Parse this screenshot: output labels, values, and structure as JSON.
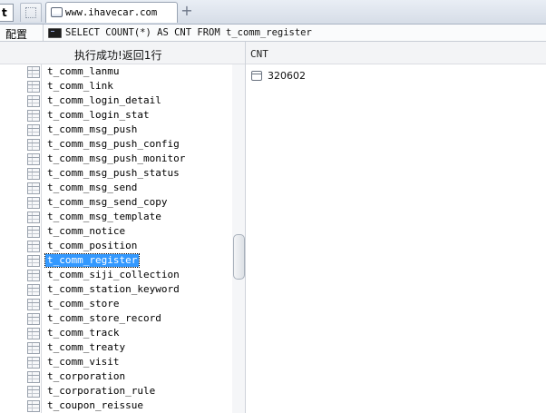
{
  "tab_bar": {
    "left_stub": "t",
    "active_tab_title": "www.ihavecar.com",
    "new_tab_symbol": "+"
  },
  "toolbar": {
    "config_label": "配置",
    "sql_text": "SELECT COUNT(*) AS CNT FROM t_comm_register"
  },
  "result": {
    "status": "执行成功!返回1行",
    "column_header": "CNT",
    "rows": [
      "320602"
    ]
  },
  "tables": [
    {
      "label": "t_comm_lanmu",
      "selected": false
    },
    {
      "label": "t_comm_link",
      "selected": false
    },
    {
      "label": "t_comm_login_detail",
      "selected": false
    },
    {
      "label": "t_comm_login_stat",
      "selected": false
    },
    {
      "label": "t_comm_msg_push",
      "selected": false
    },
    {
      "label": "t_comm_msg_push_config",
      "selected": false
    },
    {
      "label": "t_comm_msg_push_monitor",
      "selected": false
    },
    {
      "label": "t_comm_msg_push_status",
      "selected": false
    },
    {
      "label": "t_comm_msg_send",
      "selected": false
    },
    {
      "label": "t_comm_msg_send_copy",
      "selected": false
    },
    {
      "label": "t_comm_msg_template",
      "selected": false
    },
    {
      "label": "t_comm_notice",
      "selected": false
    },
    {
      "label": "t_comm_position",
      "selected": false
    },
    {
      "label": "t_comm_register",
      "selected": true
    },
    {
      "label": "t_comm_siji_collection",
      "selected": false
    },
    {
      "label": "t_comm_station_keyword",
      "selected": false
    },
    {
      "label": "t_comm_store",
      "selected": false
    },
    {
      "label": "t_comm_store_record",
      "selected": false
    },
    {
      "label": "t_comm_track",
      "selected": false
    },
    {
      "label": "t_comm_treaty",
      "selected": false
    },
    {
      "label": "t_comm_visit",
      "selected": false
    },
    {
      "label": "t_corporation",
      "selected": false
    },
    {
      "label": "t_corporation_rule",
      "selected": false
    },
    {
      "label": "t_coupon_reissue",
      "selected": false
    }
  ],
  "colors": {
    "selection": "#3399ff",
    "tab_strip": "#dfe5ec"
  }
}
